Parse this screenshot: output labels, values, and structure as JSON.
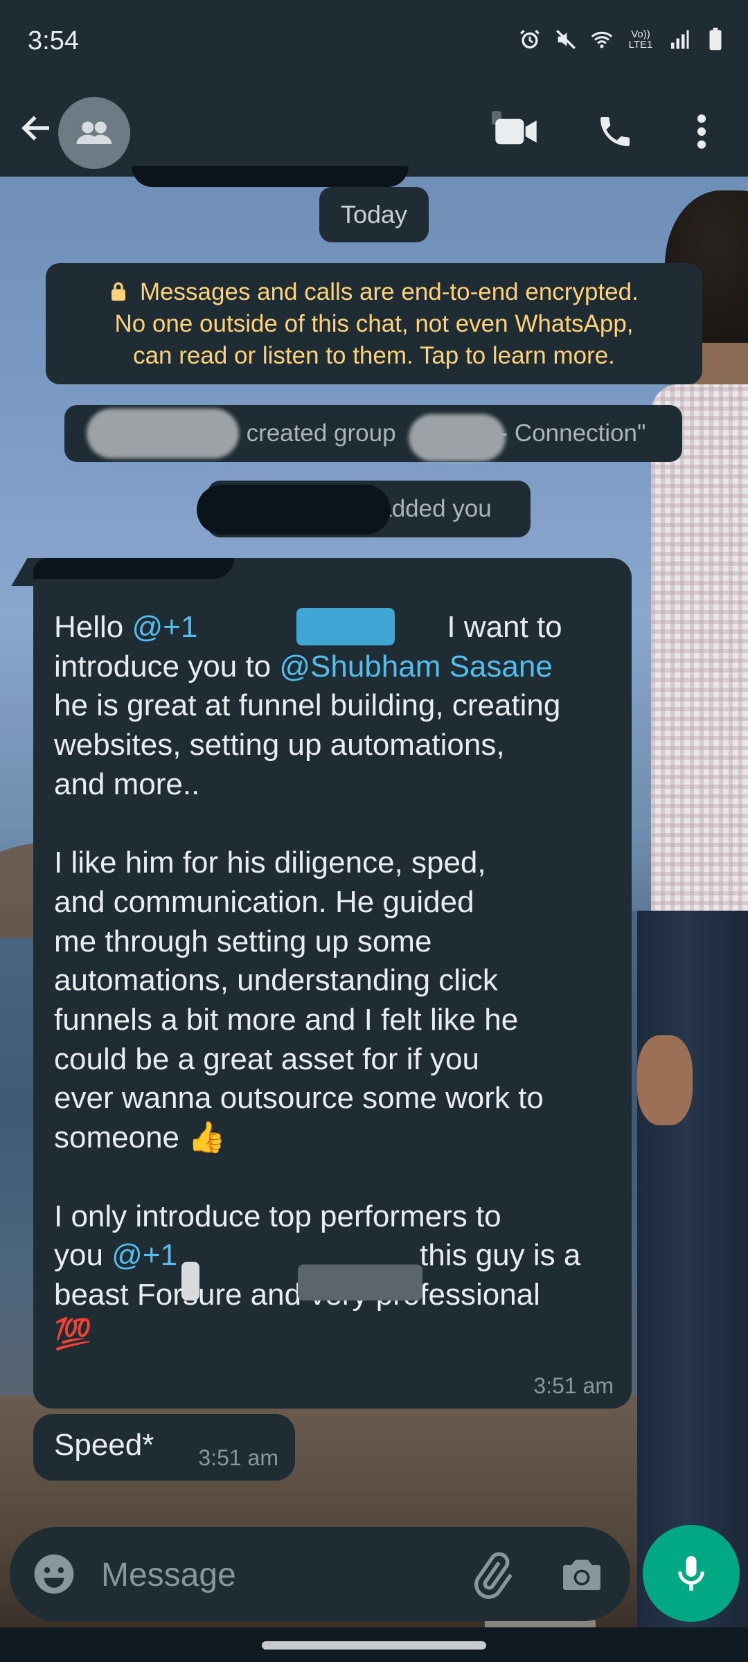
{
  "status_bar": {
    "time": "3:54",
    "icons": [
      "alarm-icon",
      "mute-icon",
      "wifi-icon",
      "volte-icon",
      "signal-icon",
      "battery-icon"
    ],
    "volte_label": "Vo)) LTE1"
  },
  "header": {
    "icons": [
      "back-arrow-icon",
      "group-avatar-icon",
      "video-call-icon",
      "voice-call-icon",
      "more-options-icon"
    ]
  },
  "chat": {
    "date_chip": "Today",
    "encryption_notice": {
      "line1": "Messages and calls are end-to-end encrypted.",
      "line2": "No one outside of this chat, not even WhatsApp,",
      "line3": "can read or listen to them. Tap to learn more."
    },
    "system_messages": [
      {
        "text_a": "created group",
        "text_b": "- Connection\""
      },
      {
        "text": "added you"
      }
    ],
    "messages": [
      {
        "p1_a": "Hello ",
        "p1_mention1": "@+1",
        "p1_b": "I want to",
        "p1_c": "introduce you to ",
        "p1_mention2": "@Shubham Sasane",
        "p1_d": "he is great at funnel building, creating",
        "p1_e": "websites, setting up automations,",
        "p1_f": "and more..",
        "p2_a": "I like him for his diligence, sped,",
        "p2_b": "and communication. He guided",
        "p2_c": "me through setting up some",
        "p2_d": "automations, understanding click",
        "p2_e": "funnels a bit more and I felt like he",
        "p2_f": "could be a great asset for if you",
        "p2_g": "ever wanna outsource some work to",
        "p2_h": "someone",
        "p2_emoji": "👍",
        "p3_a": "I only introduce top performers to",
        "p3_b": "you ",
        "p3_mention": "@+1",
        "p3_c": "this guy is a",
        "p3_d": "beast Forsure and very professional",
        "p3_emoji": "💯",
        "time": "3:51 am"
      },
      {
        "text": "Speed*",
        "time": "3:51 am"
      }
    ]
  },
  "composer": {
    "placeholder": "Message",
    "icons": [
      "emoji-icon",
      "attach-icon",
      "camera-icon",
      "mic-icon"
    ]
  },
  "colors": {
    "bubble": "#1f2c34",
    "mention": "#53bdeb",
    "encryption_text": "#ffd279",
    "accent": "#00a884"
  }
}
